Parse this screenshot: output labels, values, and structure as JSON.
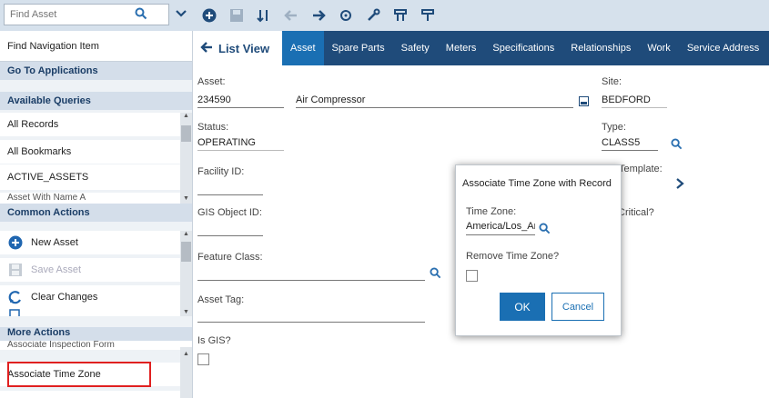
{
  "sidebar": {
    "find_asset_placeholder": "Find Asset",
    "find_navigation_item": "Find Navigation Item",
    "go_to_applications": "Go To Applications",
    "available_queries": "Available Queries",
    "queries": [
      "All Records",
      "All Bookmarks",
      "ACTIVE_ASSETS",
      "Asset With Name A"
    ],
    "common_actions": "Common Actions",
    "actions": [
      "New Asset",
      "Save Asset",
      "Clear Changes"
    ],
    "more_actions": "More Actions",
    "more_actions_items": [
      "Associate Inspection Form",
      "Associate Time Zone"
    ]
  },
  "tabs": {
    "list_view": "List View",
    "items": [
      "Asset",
      "Spare Parts",
      "Safety",
      "Meters",
      "Specifications",
      "Relationships",
      "Work",
      "Service Address"
    ],
    "active": "Asset"
  },
  "form": {
    "asset_label": "Asset:",
    "asset_value": "234590",
    "asset_description": "Air Compressor",
    "site_label": "Site:",
    "site_value": "BEDFORD",
    "status_label": "Status:",
    "status_value": "OPERATING",
    "type_label": "Type:",
    "type_value": "CLASS5",
    "facility_label": "Facility ID:",
    "template_label": "Template:",
    "gis_object_label": "GIS Object ID:",
    "critical_label": "Critical?",
    "feature_class_label": "Feature Class:",
    "asset_tag_label": "Asset Tag:",
    "is_gis_label": "Is GIS?"
  },
  "modal": {
    "title": "Associate Time Zone with Record",
    "time_zone_label": "Time Zone:",
    "time_zone_value": "America/Los_Ar",
    "remove_label": "Remove Time Zone?",
    "ok": "OK",
    "cancel": "Cancel"
  },
  "colors": {
    "tabbar": "#1f4b7a",
    "active_tab": "#1a6fb3",
    "highlight": "#e02020"
  }
}
